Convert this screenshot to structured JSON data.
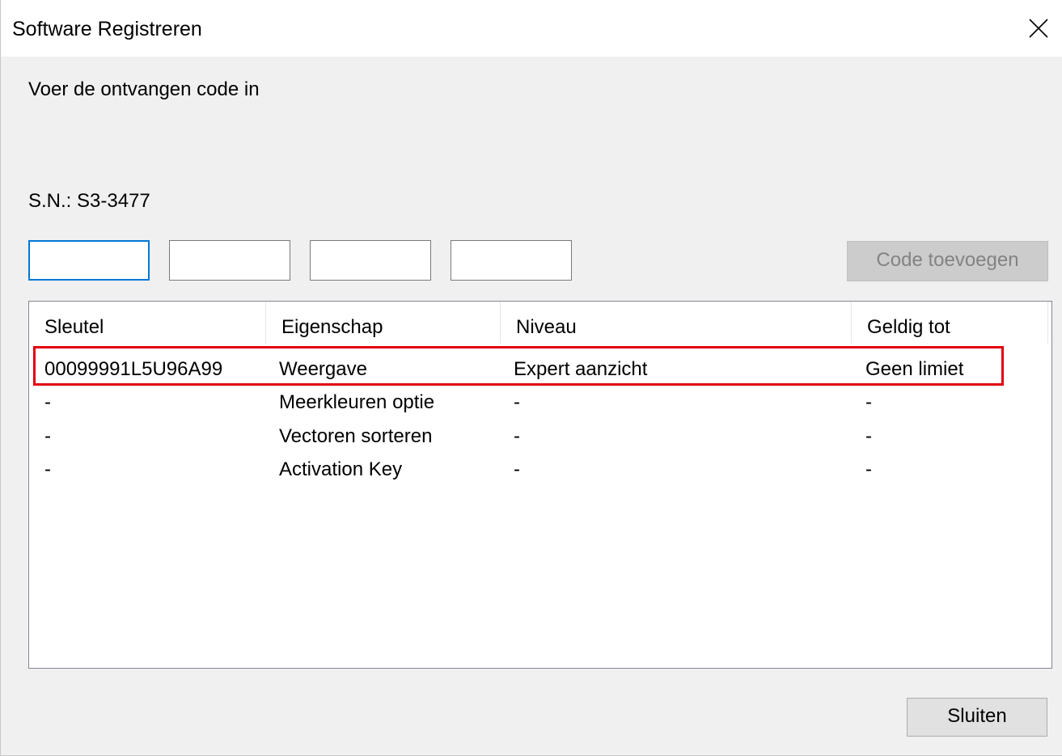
{
  "window": {
    "title": "Software Registreren",
    "close_icon": "close-icon"
  },
  "instruction": "Voer de ontvangen code in",
  "serial": "S.N.: S3-3477",
  "code_inputs": [
    {
      "value": ""
    },
    {
      "value": ""
    },
    {
      "value": ""
    },
    {
      "value": ""
    }
  ],
  "add_button": {
    "label": "Code toevoegen",
    "enabled": false
  },
  "table": {
    "columns": [
      "Sleutel",
      "Eigenschap",
      "Niveau",
      "Geldig tot"
    ],
    "rows": [
      {
        "sleutel": "00099991L5U96A99",
        "eigenschap": "Weergave",
        "niveau": "Expert aanzicht",
        "geldig_tot": "Geen limiet"
      },
      {
        "sleutel": "-",
        "eigenschap": "Meerkleuren optie",
        "niveau": "-",
        "geldig_tot": "-"
      },
      {
        "sleutel": "-",
        "eigenschap": "Vectoren sorteren",
        "niveau": "-",
        "geldig_tot": "-"
      },
      {
        "sleutel": "-",
        "eigenschap": "Activation Key",
        "niveau": "-",
        "geldig_tot": "-"
      }
    ]
  },
  "highlight_color": "#e3000f",
  "footer": {
    "close_label": "Sluiten"
  }
}
